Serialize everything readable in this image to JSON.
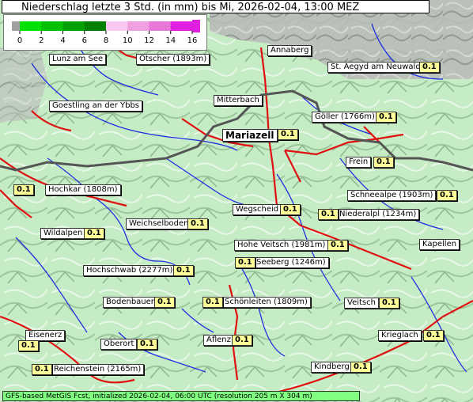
{
  "title": "Niederschlag letzte 3 Std. (in mm) bis Mi, 2026-02-04, 13:00 MEZ",
  "legend": {
    "ticks": [
      "0",
      "2",
      "4",
      "6",
      "8",
      "10",
      "12",
      "14",
      "16"
    ],
    "colors": [
      "#a0a0a0",
      "#00e000",
      "#00c000",
      "#00a000",
      "#008000",
      "#f8c8f0",
      "#f0a0e0",
      "#e878d8",
      "#e020e0"
    ]
  },
  "places": [
    {
      "name": "Lunz am See"
    },
    {
      "name": "Ötscher (1893m)"
    },
    {
      "name": "Annaberg"
    },
    {
      "name": "St. Aegyd am Neuwald",
      "value": "0.1"
    },
    {
      "name": "Goestling an der Ybbs"
    },
    {
      "name": "Mitterbach"
    },
    {
      "name": "Göller (1766m)",
      "value": "0.1"
    },
    {
      "name": "Mariazell",
      "value": "0.1"
    },
    {
      "name": "Frein",
      "value": "0.1"
    },
    {
      "name": "Hochkar (1808m)",
      "value": "0.1"
    },
    {
      "name": "Schneealpe (1903m)",
      "value": "0.1"
    },
    {
      "name": "Wegscheid",
      "value": "0.1"
    },
    {
      "name": "Niederalpl (1234m)",
      "value": "0.1"
    },
    {
      "name": "Weichselboden",
      "value": "0.1"
    },
    {
      "name": "Wildalpen",
      "value": "0.1"
    },
    {
      "name": "Hohe Veitsch (1981m)",
      "value": "0.1"
    },
    {
      "name": "Kapellen"
    },
    {
      "name": "Seeberg (1246m)",
      "value": "0.1"
    },
    {
      "name": "Hochschwab (2277m)",
      "value": "0.1"
    },
    {
      "name": "Bodenbauer",
      "value": "0.1"
    },
    {
      "name": "Schönleiten (1809m)",
      "value": "0.1"
    },
    {
      "name": "Veitsch",
      "value": "0.1"
    },
    {
      "name": "Eisenerz",
      "value": "0.1"
    },
    {
      "name": "Oberort",
      "value": "0.1"
    },
    {
      "name": "Aflenz",
      "value": "0.1"
    },
    {
      "name": "Krieglach",
      "value": "0.1"
    },
    {
      "name": "Reichenstein (2165m)",
      "value": "0.1"
    },
    {
      "name": "Kindberg",
      "value": "0.1"
    }
  ],
  "footer": "GFS-based MetGIS Fcst, initialized 2026-02-04, 06:00 UTC  (resolution 205 m X 304 m)"
}
